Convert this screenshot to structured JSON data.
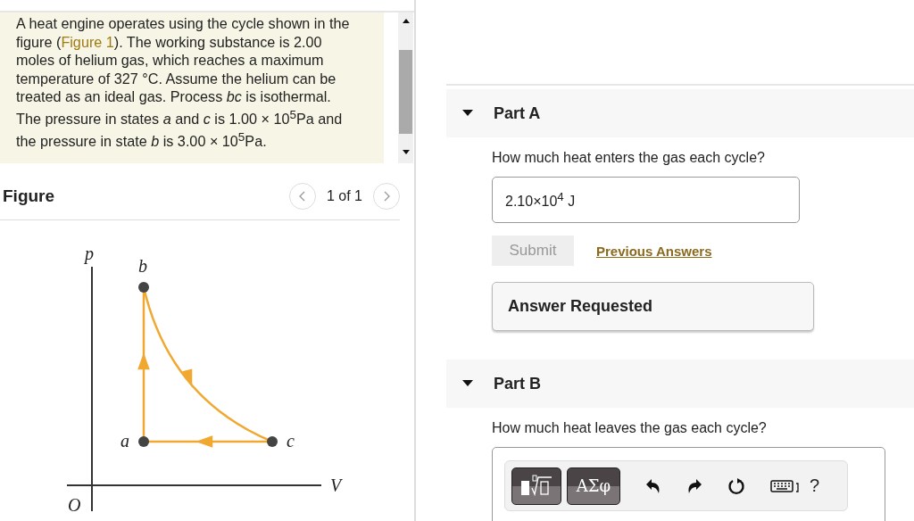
{
  "problem": {
    "before": "A heat engine operates using the cycle shown in the figure (",
    "link": "Figure 1",
    "after": "). The working substance is 2.00 moles of helium gas, which reaches a maximum temperature of 327 °C. Assume the helium can be treated as an ideal gas. Process *bc* is isothermal. The pressure in states *a* and *c* is 1.00 × 10$^{5}$Pa and the pressure in state *b* is 3.00 × 10$^{5}$Pa."
  },
  "figure": {
    "title": "Figure",
    "pager": "1 of 1",
    "labels": {
      "p": "p",
      "V": "V",
      "O": "O",
      "a": "a",
      "b": "b",
      "c": "c"
    }
  },
  "parts": [
    {
      "kind": "answered",
      "title": "Part A",
      "expanded": true,
      "question": "How much heat enters the gas each cycle?",
      "answer": "2.10×10$^{4}$ J",
      "submit": {
        "label": "Submit",
        "disabled": true
      },
      "link": "Previous Answers",
      "feedback": "Answer Requested"
    },
    {
      "kind": "entry",
      "title": "Part B",
      "expanded": true,
      "question": "How much heat leaves the gas each cycle?",
      "symbols_button": "ΑΣφ",
      "help": "?"
    }
  ]
}
